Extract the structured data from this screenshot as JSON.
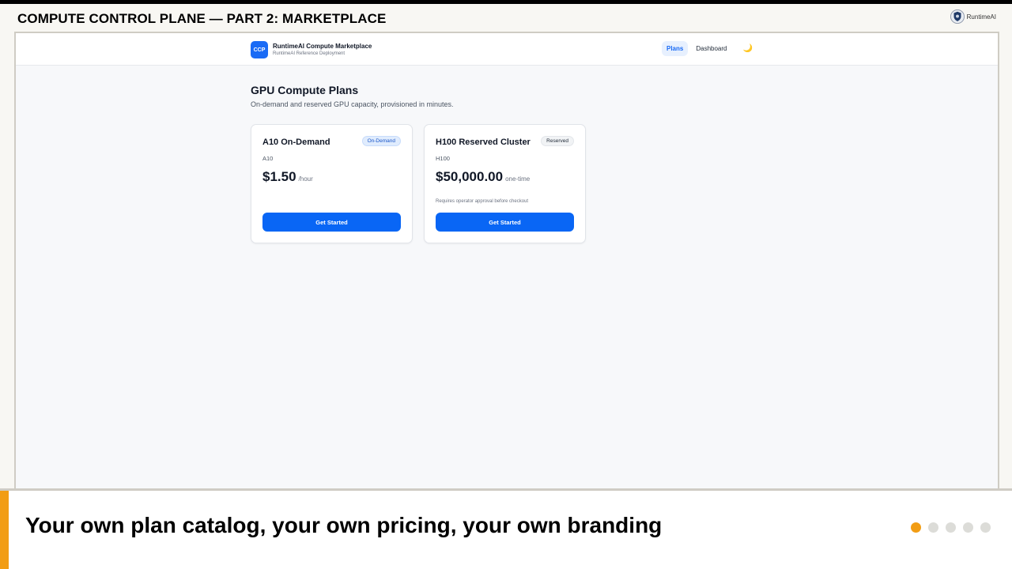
{
  "slide": {
    "title": "COMPUTE CONTROL PLANE — PART 2: MARKETPLACE",
    "logo_text": "RuntimeAI",
    "caption": "Your own plan catalog, your own pricing, your own branding",
    "progress": {
      "current": 1,
      "total": 5
    },
    "colors": {
      "accent": "#f29d14",
      "primary": "#0966f5"
    }
  },
  "app": {
    "badge": "CCP",
    "name": "RuntimeAI Compute Marketplace",
    "subtitle": "RuntimeAI Reference Deployment",
    "nav": [
      {
        "label": "Plans",
        "active": true
      },
      {
        "label": "Dashboard",
        "active": false
      }
    ],
    "theme_icon": "moon-icon"
  },
  "page": {
    "title": "GPU Compute Plans",
    "subtitle": "On-demand and reserved GPU capacity, provisioned in minutes."
  },
  "plans": [
    {
      "name": "A10 On-Demand",
      "badge": "On-Demand",
      "model": "A10",
      "price": "$1.50",
      "unit": "/hour",
      "note": "",
      "cta": "Get Started"
    },
    {
      "name": "H100 Reserved Cluster",
      "badge": "Reserved",
      "model": "H100",
      "price": "$50,000.00",
      "unit": "one-time",
      "note": "Requires operator approval before checkout",
      "cta": "Get Started"
    }
  ]
}
